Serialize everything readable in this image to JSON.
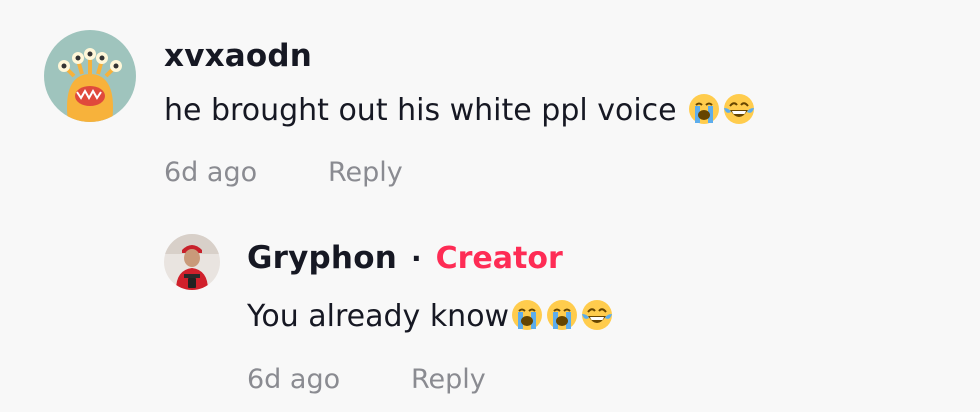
{
  "comment": {
    "username": "xvxaodn",
    "text": "he brought out his white ppl voice",
    "emojis": [
      "loudly-crying-face",
      "face-with-tears-of-joy"
    ],
    "time": "6d ago",
    "reply_label": "Reply",
    "avatar_icon": "alien-monster-avatar"
  },
  "reply": {
    "username": "Gryphon",
    "separator": "·",
    "badge": "Creator",
    "text": "You already know",
    "emojis": [
      "loudly-crying-face",
      "loudly-crying-face",
      "face-with-tears-of-joy"
    ],
    "time": "6d ago",
    "reply_label": "Reply",
    "avatar_icon": "profile-photo-avatar"
  },
  "colors": {
    "background": "#f8f8f8",
    "text": "#161823",
    "muted": "#8a8b91",
    "creator_badge": "#fe2c55"
  }
}
